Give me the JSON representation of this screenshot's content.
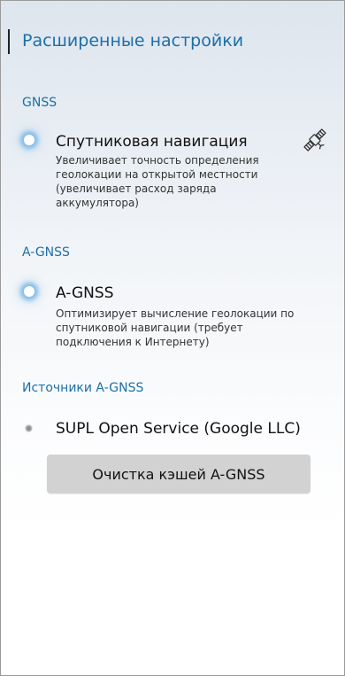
{
  "header": {
    "title": "Расширенные настройки"
  },
  "sections": {
    "gnss": {
      "title": "GNSS",
      "item": {
        "title": "Спутниковая навигация",
        "description": "Увеличивает точность определения\nгеолокации на открытой местности\n(увеличивает расход заряда\nаккумулятора)",
        "icon": "satellite-icon"
      }
    },
    "agnss": {
      "title": "A-GNSS",
      "item": {
        "title": "A-GNSS",
        "description": "Оптимизирует вычисление геолокации по\nспутниковой навигации (требует\nподключения к Интернету)"
      }
    },
    "sources": {
      "title": "Источники A-GNSS",
      "item": {
        "title": "SUPL Open Service (Google LLC)"
      },
      "button_label": "Очистка кэшей A-GNSS"
    }
  },
  "colors": {
    "accent": "#1c6fa8",
    "button_bg": "#d2d2d2"
  }
}
